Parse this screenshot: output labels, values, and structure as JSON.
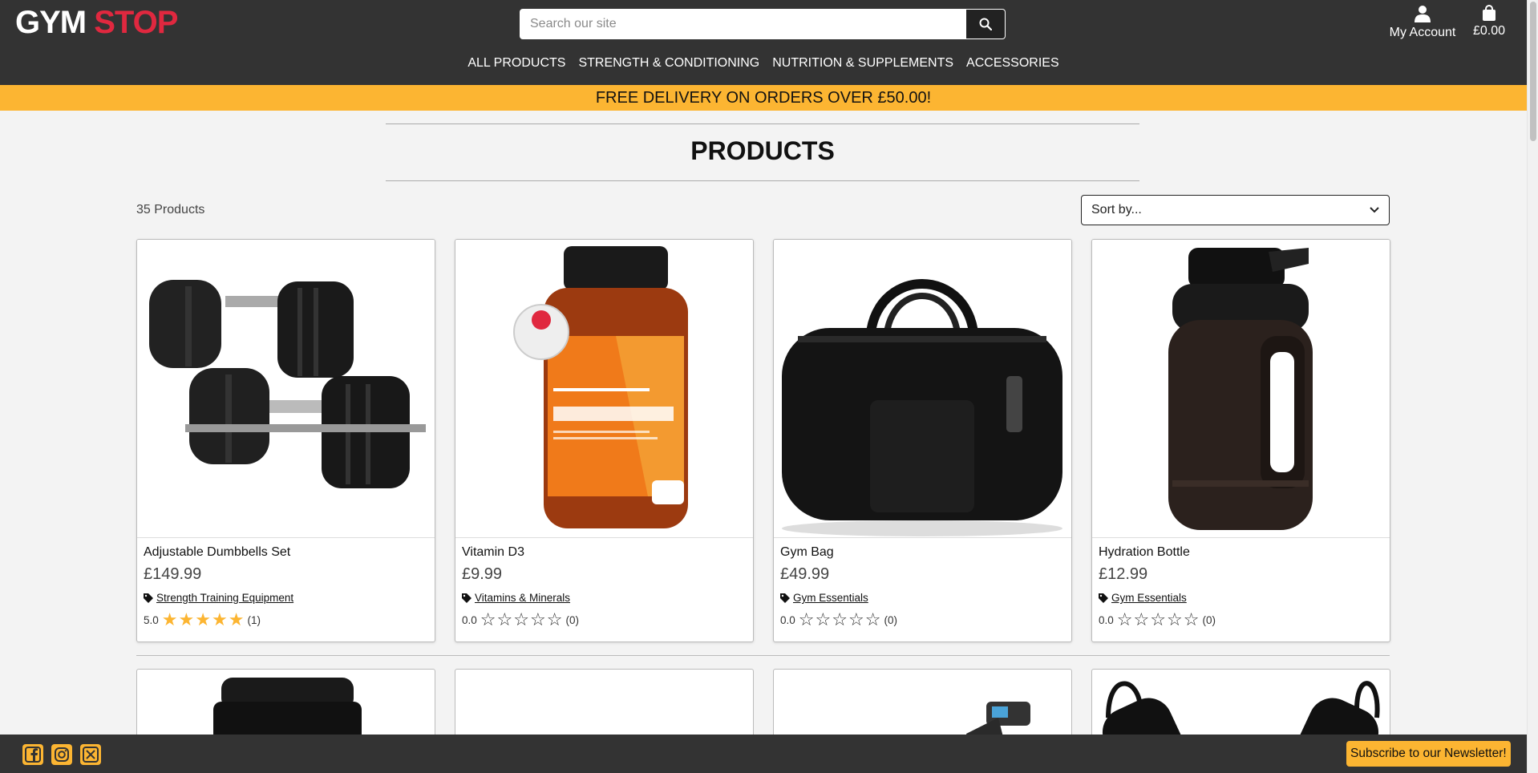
{
  "header": {
    "logo_part1": "GYM",
    "logo_part2": "STOP",
    "search_placeholder": "Search our site",
    "account_label": "My Account",
    "cart_total": "£0.00"
  },
  "nav": {
    "items": [
      "ALL PRODUCTS",
      "STRENGTH & CONDITIONING",
      "NUTRITION & SUPPLEMENTS",
      "ACCESSORIES"
    ]
  },
  "banner": {
    "text": "FREE DELIVERY ON ORDERS OVER £50.00!"
  },
  "page": {
    "title": "PRODUCTS",
    "product_count": "35 Products",
    "sort_label": "Sort by..."
  },
  "products": [
    {
      "name": "Adjustable Dumbbells Set",
      "price": "£149.99",
      "category": "Strength Training Equipment",
      "rating": "5.0",
      "stars": 5,
      "reviews": "(1)",
      "image_icon": "dumbbells-image"
    },
    {
      "name": "Vitamin D3",
      "price": "£9.99",
      "category": "Vitamins & Minerals",
      "rating": "0.0",
      "stars": 0,
      "reviews": "(0)",
      "image_icon": "vitamin-bottle-image"
    },
    {
      "name": "Gym Bag",
      "price": "£49.99",
      "category": "Gym Essentials",
      "rating": "0.0",
      "stars": 0,
      "reviews": "(0)",
      "image_icon": "duffel-bag-image"
    },
    {
      "name": "Hydration Bottle",
      "price": "£12.99",
      "category": "Gym Essentials",
      "rating": "0.0",
      "stars": 0,
      "reviews": "(0)",
      "image_icon": "water-jug-image"
    }
  ],
  "footer": {
    "newsletter_label": "Subscribe to our Newsletter!",
    "social": [
      "facebook-icon",
      "instagram-icon",
      "x-icon"
    ]
  },
  "colors": {
    "header_bg": "#333333",
    "accent": "#fcb532",
    "logo_red": "#e0283f"
  }
}
